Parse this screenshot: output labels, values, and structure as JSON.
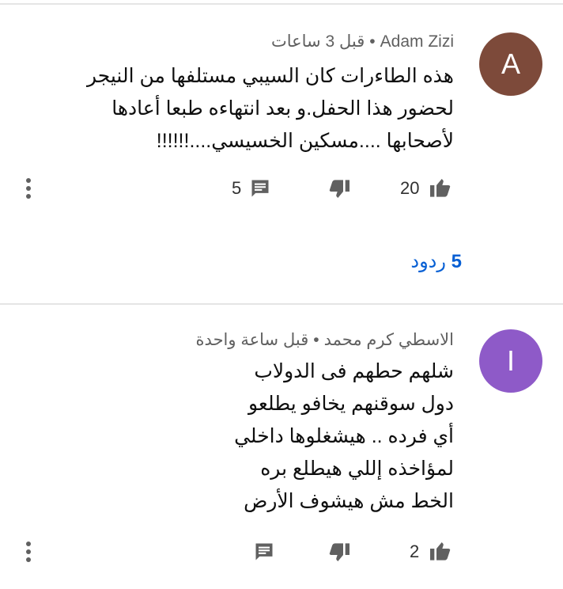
{
  "comments": [
    {
      "avatar_letter": "A",
      "avatar_color": "#7d4a3a",
      "author": "Adam Zizi",
      "time": "قبل 3 ساعات",
      "text_lines": [
        "هذه الطاءرات كان السيبي مستلفها من النيجر",
        "لحضور هذا الحفل.و بعد انتهاءه طبعا أعادها",
        "لأصحابها ....مسكين الخسيسي....!!!!!!"
      ],
      "likes": "20",
      "reply_count": "5",
      "replies_count": "5",
      "replies_label": "ردود"
    },
    {
      "avatar_letter": "I",
      "avatar_color": "#8e5ac8",
      "author": "الاسطي كرم محمد",
      "time": "قبل ساعة واحدة",
      "text_lines": [
        "شلهم حطهم فى الدولاب",
        "دول سوقنهم يخافو يطلعو",
        "أي فرده .. هيشغلوها داخلي",
        "لمؤاخذه إللي هيطلع بره",
        "الخط مش هيشوف الأرض"
      ],
      "likes": "2",
      "reply_count": ""
    }
  ],
  "separator": "•",
  "icons": {
    "like": "thumb-up-icon",
    "dislike": "thumb-down-icon",
    "reply": "comment-icon",
    "menu": "more-vert-icon"
  }
}
